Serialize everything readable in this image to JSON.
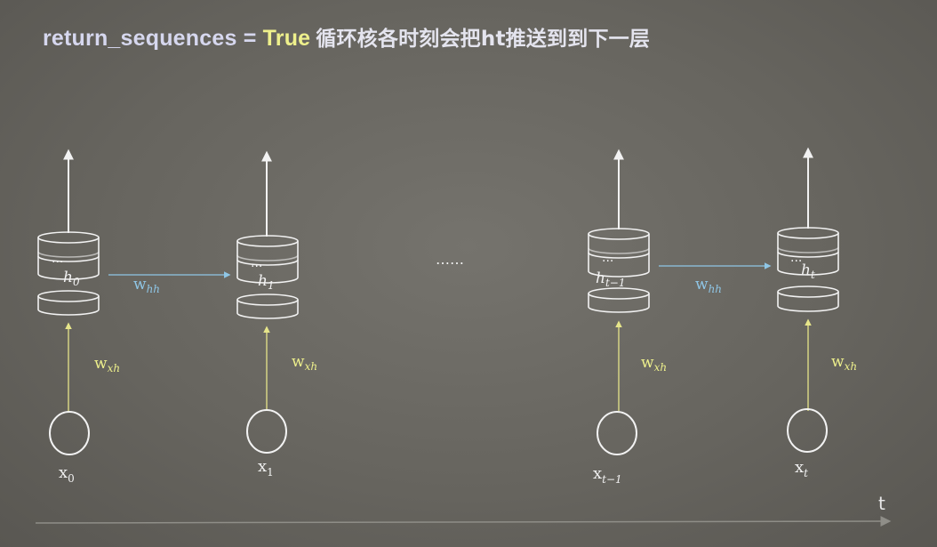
{
  "title": {
    "keyword": "return_sequences",
    "equals": " = ",
    "value": "True",
    "description": "循环核各时刻会把ht推送到到下一层"
  },
  "ellipsis": "……",
  "time_axis_label": "t",
  "cells": [
    {
      "hidden": "h",
      "hidden_sub": "0",
      "input": "x",
      "input_sub": "0",
      "input_weight": "w",
      "input_weight_sub": "xh"
    },
    {
      "hidden": "h",
      "hidden_sub": "1",
      "input": "x",
      "input_sub": "1",
      "input_weight": "w",
      "input_weight_sub": "xh"
    },
    {
      "hidden": "h",
      "hidden_sub": "t−1",
      "input": "x",
      "input_sub": "t−1",
      "input_weight": "w",
      "input_weight_sub": "xh"
    },
    {
      "hidden": "h",
      "hidden_sub": "t",
      "input": "x",
      "input_sub": "t",
      "input_weight": "w",
      "input_weight_sub": "xh"
    }
  ],
  "recurrent_weights": [
    {
      "label": "w",
      "sub": "hh"
    },
    {
      "label": "w",
      "sub": "hh"
    }
  ],
  "colors": {
    "background": "#67655f",
    "stroke": "#f2f2f2",
    "input_arrow": "#e6e58a",
    "recurrent_arrow": "#8fc6e6",
    "title_keyword": "#eef08c",
    "title_text": "#d6d7ee"
  }
}
